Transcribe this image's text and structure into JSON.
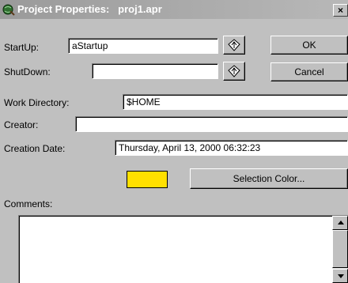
{
  "window": {
    "title": "Project Properties:   proj1.apr",
    "close_glyph": "×",
    "title_icon": "globe-icon"
  },
  "startup": {
    "label": "StartUp:",
    "value": "aStartup",
    "icon": "script-hand-icon"
  },
  "shutdown": {
    "label": "ShutDown:",
    "value": "",
    "icon": "script-hand-icon"
  },
  "buttons": {
    "ok": "OK",
    "cancel": "Cancel",
    "selection_color": "Selection Color..."
  },
  "work_directory": {
    "label": "Work Directory:",
    "value": "$HOME"
  },
  "creator": {
    "label": "Creator:",
    "value": ""
  },
  "creation_date": {
    "label": "Creation Date:",
    "value": "Thursday, April 13, 2000 06:32:23"
  },
  "selection_color": "#ffe000",
  "comments": {
    "label": "Comments:",
    "value": ""
  },
  "colors": {
    "face": "#c0c0c0",
    "titlebar": "#9a9a9a"
  }
}
